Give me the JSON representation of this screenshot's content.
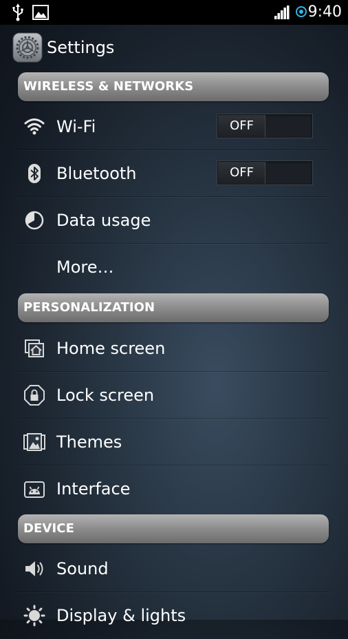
{
  "status_bar": {
    "time": "9:40",
    "icons": [
      "usb-icon",
      "image-notification-icon",
      "signal-icon",
      "data-sync-icon"
    ]
  },
  "action_bar": {
    "title": "Settings",
    "icon": "settings-gear-icon"
  },
  "sections": {
    "wireless": {
      "title": "WIRELESS & NETWORKS"
    },
    "personalization": {
      "title": "PERSONALIZATION"
    },
    "device": {
      "title": "DEVICE"
    }
  },
  "items": {
    "wifi": {
      "label": "Wi-Fi",
      "icon": "wifi-icon",
      "toggle": "OFF"
    },
    "bluetooth": {
      "label": "Bluetooth",
      "icon": "bluetooth-icon",
      "toggle": "OFF"
    },
    "data_usage": {
      "label": "Data usage",
      "icon": "data-usage-icon"
    },
    "more": {
      "label": "More…"
    },
    "home_screen": {
      "label": "Home screen",
      "icon": "home-screen-icon"
    },
    "lock_screen": {
      "label": "Lock screen",
      "icon": "lock-icon"
    },
    "themes": {
      "label": "Themes",
      "icon": "themes-icon"
    },
    "interface": {
      "label": "Interface",
      "icon": "android-icon"
    },
    "sound": {
      "label": "Sound",
      "icon": "speaker-icon"
    },
    "display": {
      "label": "Display & lights",
      "icon": "brightness-icon"
    }
  },
  "colors": {
    "background": "#1b2430",
    "status_bar": "#000000",
    "section_header": "#8f8f8f",
    "text": "#ffffff",
    "sync_accent": "#33b5e5"
  }
}
